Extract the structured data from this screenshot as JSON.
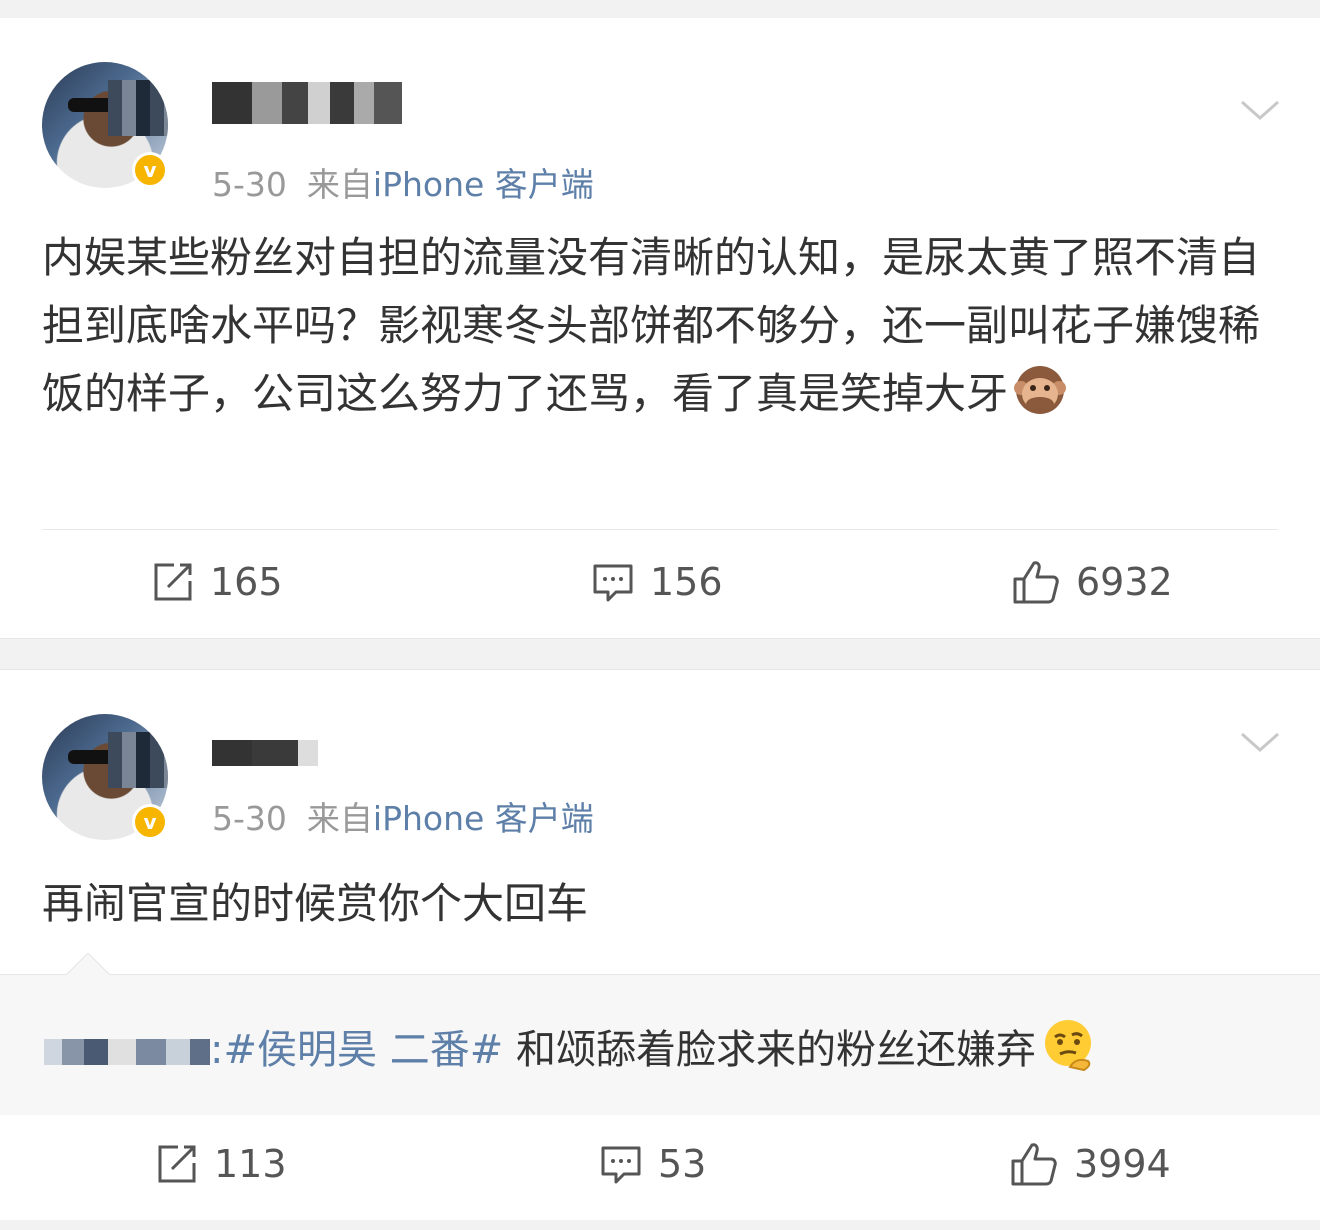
{
  "posts": [
    {
      "time": "5-30",
      "source_prefix": "来自",
      "source": "iPhone 客户端",
      "verified_badge": "v",
      "content": "内娱某些粉丝对自担的流量没有清晰的认知，是尿太黄了照不清自担到底啥水平吗？影视寒冬头部饼都不够分，还一副叫花子嫌馊稀饭的样子，公司这么努力了还骂，看了真是笑掉大牙",
      "content_emoji": "see-no-evil-monkey",
      "repost_count": "165",
      "comment_count": "156",
      "like_count": "6932"
    },
    {
      "time": "5-30",
      "source_prefix": "来自",
      "source": "iPhone 客户端",
      "verified_badge": "v",
      "content": "再闹官宣的时候赏你个大回车",
      "quoted": {
        "user_suffix": ":",
        "hashtag": "#侯明昊 二番#",
        "text": " 和颂舔着脸求来的粉丝还嫌弃",
        "emoji": "thinking-face"
      },
      "repost_count": "113",
      "comment_count": "53",
      "like_count": "3994"
    }
  ],
  "icons": {
    "repost": "repost-icon",
    "comment": "comment-icon",
    "like": "thumbs-up-icon",
    "menu": "chevron-down-icon"
  },
  "colors": {
    "link": "#5d7fa8",
    "badge": "#f7b500",
    "text": "#333333",
    "meta": "#999999"
  }
}
